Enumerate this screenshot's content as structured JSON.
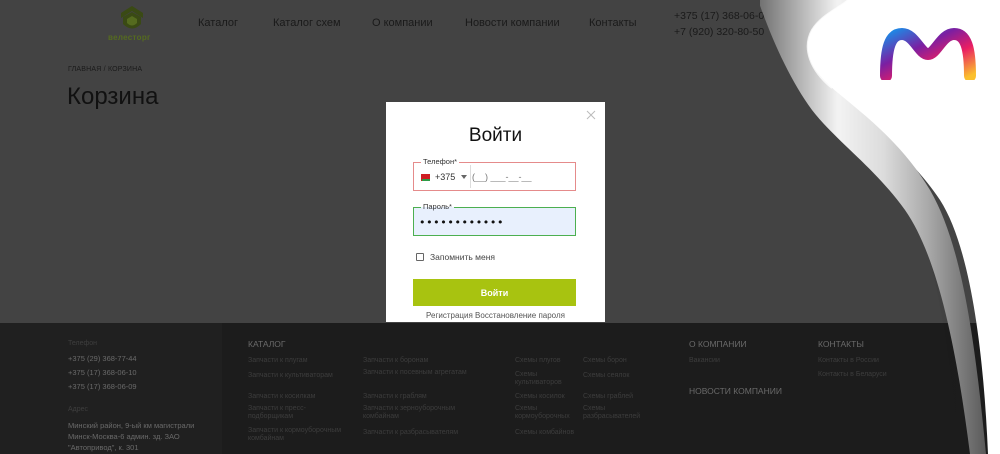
{
  "header": {
    "logo_text": "велесторг",
    "nav": [
      "Каталог",
      "Каталог схем",
      "О компании",
      "Новости компании",
      "Контакты"
    ],
    "phones": [
      "+375 (17) 368-06-09",
      "+7 (920) 320-80-50"
    ]
  },
  "breadcrumb": "ГЛАВНАЯ / КОРЗИНА",
  "page_title": "Корзина",
  "modal": {
    "title": "Войти",
    "phone_label": "Телефон*",
    "country_code": "+375",
    "phone_placeholder": "(__) ___-__-__",
    "password_label": "Пароль*",
    "password_value": "••••••••••••",
    "remember_label": "Запомнить меня",
    "submit_label": "Войти",
    "register_link": "Регистрация",
    "restore_link": "Восстановление пароля"
  },
  "footer": {
    "phones_label": "Телефон",
    "phones": [
      "+375 (29) 368-77-44",
      "+375 (17) 368-06-10",
      "+375 (17) 368-06-09"
    ],
    "address_label": "Адрес",
    "address_lines": [
      "Минский район, 9-ый км магистрали",
      "Минск-Москва-6 админ. зд. ЗАО",
      "\"Автопривод\", к. 301"
    ],
    "catalog_head": "КАТАЛОГ",
    "catalog_col1": [
      "Запчасти к плугам",
      "Запчасти к культиваторам",
      "Запчасти к косилкам",
      "Запчасти к пресс-подборщикам",
      "Запчасти к кормоуборочным комбайнам"
    ],
    "catalog_col2": [
      "Запчасти к боронам",
      "Запчасти к посевным агрегатам",
      "Запчасти к граблям",
      "Запчасти к зерноуборочным комбайнам",
      "Запчасти к разбрасывателям"
    ],
    "schemes_col1": [
      "Схемы плугов",
      "Схемы культиваторов",
      "Схемы косилок",
      "Схемы кормоуборочных",
      "Схемы комбайнов"
    ],
    "schemes_col2": [
      "Схемы борон",
      "Схемы сеялок",
      "Схемы граблей",
      "Схемы разбрасывателей"
    ],
    "about_head": "О КОМПАНИИ",
    "about_items": [
      "Вакансии"
    ],
    "news_head": "НОВОСТИ КОМПАНИИ",
    "contacts_head": "КОНТАКТЫ",
    "contacts_items": [
      "Контакты в России",
      "Контакты в Беларуси"
    ]
  },
  "colors": {
    "accent": "#a8c310",
    "overlay": "#434343",
    "footer": "#1c1c1c",
    "error_border": "#e58b8b",
    "valid_border": "#4caf50"
  }
}
